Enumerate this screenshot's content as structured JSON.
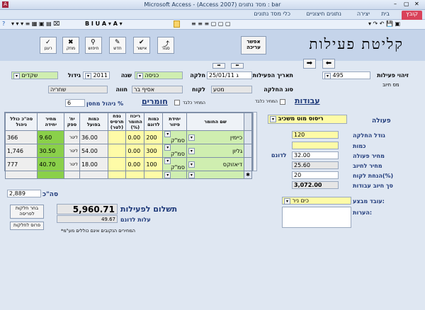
{
  "window": {
    "title": "Microsoft Access - (Access 2007) מסד נתונים : bar"
  },
  "ribbon": {
    "tabs": [
      "קובץ",
      "בית",
      "יצירה",
      "נתונים חיצוניים",
      "כלי מסד נתונים"
    ]
  },
  "form": {
    "title": "קליטת פעילות",
    "open_button": "אפשר עריכה",
    "toolbar": [
      "סגור",
      "אישור",
      "חדש",
      "חיפוש",
      "מחק",
      "רענן"
    ]
  },
  "top": {
    "activity_id_label": "זיהוי פעילות",
    "activity_id_value": "495",
    "serial_label": "מס חיוב",
    "date_label": "תאריך הפעילות",
    "date_value": "25/01/11 ג",
    "plot_label": "חלקה",
    "plot_value": "כניסה",
    "year_label": "שנה",
    "year_value": "2011",
    "crop_label": "גידול",
    "crop_value": "שקדים",
    "plot_type_label": "סוג החלקה",
    "plot_type_value": "מטע",
    "customer_label": "לקוח",
    "customer_value": "אסיף בר",
    "farm_label": "חווה",
    "farm_value": "שחריה"
  },
  "right": {
    "works_link": "עבודות",
    "price_nav_label": "המחיר כלבד",
    "activity_label": "פעולה",
    "activity_value": "ריסוס מוט משכיב",
    "plot_size_label": "גודל החלקה",
    "plot_size_value": "120",
    "qty_label": "כמות",
    "qty_value": "",
    "price_label": "מחיר פעולה",
    "price_value": "32.00",
    "per_dunam": "לדונם",
    "charge_label": "מחיר לחיוב",
    "charge_value": "25.60",
    "discount_label": "הנחת לקוח(%)",
    "discount_value": "20",
    "total_label": "סך חיוב עבודות",
    "total_value": "3,072.00",
    "worker_label": "עובד מבצע:",
    "worker_value": "כים ניר",
    "notes_label": "הערות:"
  },
  "materials": {
    "link": "חומרים",
    "price_only": "המחיר כלבד",
    "mgmt_pct_label": "ניהול מחסן %",
    "mgmt_pct_value": "6",
    "headers": [
      "שם החומר",
      "יחידת פיזור",
      "כמות לדונם",
      "ריכוז החומר (%)",
      "נפח תרסיס (לטר)",
      "כמות בפועל",
      "יח' ספק",
      "מחיר יחידה",
      "סה\"כ כולל ניהול"
    ],
    "rows": [
      {
        "name": "כיימין",
        "unit": "סמ\"ק",
        "perdunam": "200",
        "conc": "0.00",
        "vol": "",
        "actual": "36.00",
        "sunit": "ליטר",
        "price": "9.60",
        "total": "366"
      },
      {
        "name": "גליון",
        "unit": "סמ\"ק",
        "perdunam": "300",
        "conc": "0.00",
        "vol": "",
        "actual": "54.00",
        "sunit": "ליטר",
        "price": "30.50",
        "total": "1,746"
      },
      {
        "name": "דיאזוקס",
        "unit": "סמ\"ק",
        "perdunam": "100",
        "conc": "0.00",
        "vol": "",
        "actual": "18.00",
        "sunit": "ליטר",
        "price": "40.70",
        "total": "777"
      }
    ],
    "sum_label": "סה\"כ",
    "sum_value": "2,889"
  },
  "bottom": {
    "payment_label": "תשלום לפעילות",
    "payment_value": "5,960.71",
    "cost_per_dunam_label": "עלות לדונם",
    "cost_per_dunam_value": "49.67",
    "note": "*המחירים הנקובים אינם כוללים מע\"מ",
    "choose_plots_button": "בחר חלקות לפריסה",
    "spread_button": "פרוס לחלקות"
  }
}
